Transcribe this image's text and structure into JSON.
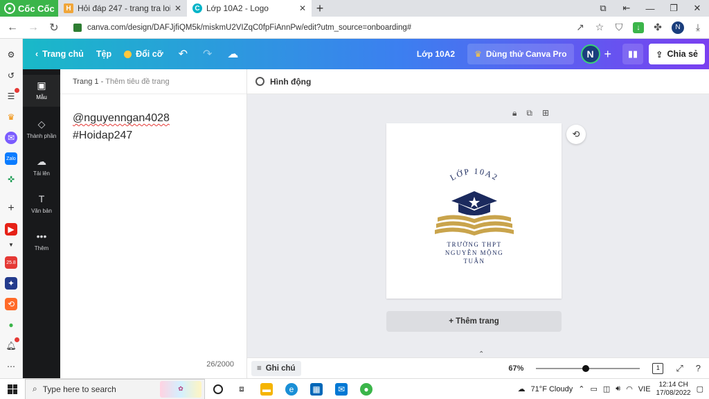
{
  "browser": {
    "brand": "Cốc Cốc",
    "tabs": [
      {
        "title": "Hỏi đáp 247 - trang tra loi",
        "favicon": "H",
        "favicon_color": "#f0a63a"
      },
      {
        "title": "Lớp 10A2 - Logo",
        "favicon": "C",
        "favicon_color": "#00b4c8"
      }
    ],
    "url": "canva.com/design/DAFJjfiQM5k/miskmU2VIZqC0fpFiAnnPw/edit?utm_source=onboarding#",
    "profile_initial": "N"
  },
  "canva": {
    "nav": {
      "home": "Trang chủ",
      "file": "Tệp",
      "resize": "Đổi cỡ"
    },
    "project_name": "Lớp 10A2",
    "try_pro": "Dùng thử Canva Pro",
    "avatar_initial": "N",
    "share": "Chia sẻ",
    "sidebar": [
      {
        "label": "Mẫu",
        "icon": "layout-icon",
        "glyph": "▣"
      },
      {
        "label": "Thành phần",
        "icon": "shapes-icon",
        "glyph": "◇"
      },
      {
        "label": "Tải lên",
        "icon": "upload-cloud-icon",
        "glyph": "☁"
      },
      {
        "label": "Văn bản",
        "icon": "text-icon",
        "glyph": "T"
      },
      {
        "label": "Thêm",
        "icon": "more-icon",
        "glyph": "•••"
      }
    ],
    "notes": {
      "page_label": "Trang 1",
      "page_title_placeholder": "Thêm tiêu đề trang",
      "line1": "@nguyenngan4028",
      "line2": "#Hoidap247",
      "counter": "26/2000"
    },
    "animate": "Hình động",
    "logo": {
      "arc_text": "LỚP 10A2",
      "line1": "TRƯỜNG THPT",
      "line2": "NGUYỄN MỘNG",
      "line3": "TUÂN",
      "navy": "#1b2a5e",
      "gold": "#c9a44c"
    },
    "add_page": "+ Thêm trang",
    "notes_button": "Ghi chú",
    "zoom": "67%",
    "zoom_fraction": 0.48,
    "page_count": "1"
  },
  "taskbar": {
    "search_placeholder": "Type here to search",
    "weather": "71°F  Cloudy",
    "lang": "VIE",
    "time": "12:14 CH",
    "date": "17/08/2022"
  }
}
